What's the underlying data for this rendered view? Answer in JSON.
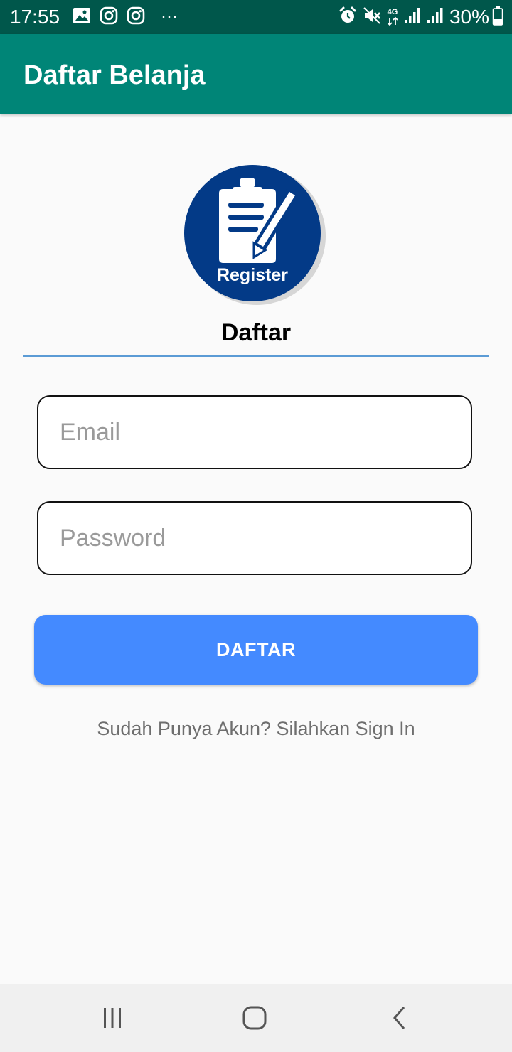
{
  "status_bar": {
    "time": "17:55",
    "network": "4G",
    "battery": "30%",
    "more": "···",
    "left_icons": [
      "gallery-icon",
      "instagram-icon",
      "instagram-icon",
      "more-icon"
    ],
    "right_icons": [
      "alarm-icon",
      "mute-icon",
      "network-4g-icon",
      "signal-icon",
      "signal-icon",
      "battery-icon"
    ]
  },
  "app_bar": {
    "title": "Daftar Belanja"
  },
  "logo": {
    "label": "Register"
  },
  "form": {
    "title": "Daftar",
    "email_placeholder": "Email",
    "password_placeholder": "Password",
    "submit_label": "DAFTAR",
    "signin_text": "Sudah Punya Akun? Silahkan Sign In"
  },
  "nav_bar": {
    "buttons": [
      "recents-icon",
      "home-icon",
      "back-icon"
    ]
  },
  "colors": {
    "status_bar": "#00574b",
    "app_bar": "#008577",
    "logo_circle": "#033a87",
    "divider": "#5b9bd5",
    "button": "#448aff",
    "background": "#fafafa"
  }
}
